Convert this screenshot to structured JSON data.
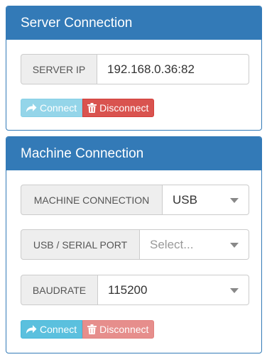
{
  "server_panel": {
    "title": "Server Connection",
    "ip_label": "SERVER IP",
    "ip_value": "192.168.0.36:82",
    "connect_label": "Connect",
    "disconnect_label": "Disconnect",
    "connect_icon": "share-arrow-icon",
    "disconnect_icon": "trash-icon"
  },
  "machine_panel": {
    "title": "Machine Connection",
    "connection_label": "MACHINE CONNECTION",
    "connection_value": "USB",
    "port_label": "USB / SERIAL PORT",
    "port_placeholder": "Select...",
    "baud_label": "BAUDRATE",
    "baud_value": "115200",
    "connect_label": "Connect",
    "disconnect_label": "Disconnect"
  },
  "colors": {
    "primary": "#337ab7",
    "info": "#5bc0de",
    "danger": "#d9534f"
  }
}
